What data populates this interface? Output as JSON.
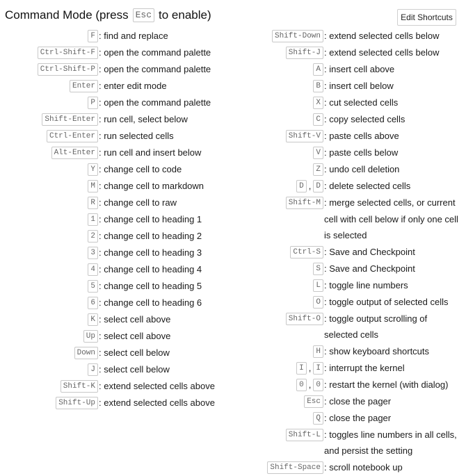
{
  "header": {
    "title_pre": "Command Mode (press",
    "title_key": "Esc",
    "title_post": "to enable)",
    "edit_button": "Edit Shortcuts"
  },
  "left": [
    {
      "keys": [
        "F"
      ],
      "desc": ": find and replace"
    },
    {
      "keys": [
        "Ctrl-Shift-F"
      ],
      "desc": ": open the command palette"
    },
    {
      "keys": [
        "Ctrl-Shift-P"
      ],
      "desc": ": open the command palette"
    },
    {
      "keys": [
        "Enter"
      ],
      "desc": ": enter edit mode"
    },
    {
      "keys": [
        "P"
      ],
      "desc": ": open the command palette"
    },
    {
      "keys": [
        "Shift-Enter"
      ],
      "desc": ": run cell, select below"
    },
    {
      "keys": [
        "Ctrl-Enter"
      ],
      "desc": ": run selected cells"
    },
    {
      "keys": [
        "Alt-Enter"
      ],
      "desc": ": run cell and insert below"
    },
    {
      "keys": [
        "Y"
      ],
      "desc": ": change cell to code"
    },
    {
      "keys": [
        "M"
      ],
      "desc": ": change cell to markdown"
    },
    {
      "keys": [
        "R"
      ],
      "desc": ": change cell to raw"
    },
    {
      "keys": [
        "1"
      ],
      "desc": ": change cell to heading 1"
    },
    {
      "keys": [
        "2"
      ],
      "desc": ": change cell to heading 2"
    },
    {
      "keys": [
        "3"
      ],
      "desc": ": change cell to heading 3"
    },
    {
      "keys": [
        "4"
      ],
      "desc": ": change cell to heading 4"
    },
    {
      "keys": [
        "5"
      ],
      "desc": ": change cell to heading 5"
    },
    {
      "keys": [
        "6"
      ],
      "desc": ": change cell to heading 6"
    },
    {
      "keys": [
        "K"
      ],
      "desc": ": select cell above"
    },
    {
      "keys": [
        "Up"
      ],
      "desc": ": select cell above"
    },
    {
      "keys": [
        "Down"
      ],
      "desc": ": select cell below"
    },
    {
      "keys": [
        "J"
      ],
      "desc": ": select cell below"
    },
    {
      "keys": [
        "Shift-K"
      ],
      "desc": ": extend selected cells above"
    },
    {
      "keys": [
        "Shift-Up"
      ],
      "desc": ": extend selected cells above"
    }
  ],
  "right": [
    {
      "keys": [
        "Shift-Down"
      ],
      "desc": ": extend selected cells below"
    },
    {
      "keys": [
        "Shift-J"
      ],
      "desc": ": extend selected cells below"
    },
    {
      "keys": [
        "A"
      ],
      "desc": ": insert cell above"
    },
    {
      "keys": [
        "B"
      ],
      "desc": ": insert cell below"
    },
    {
      "keys": [
        "X"
      ],
      "desc": ": cut selected cells"
    },
    {
      "keys": [
        "C"
      ],
      "desc": ": copy selected cells"
    },
    {
      "keys": [
        "Shift-V"
      ],
      "desc": ": paste cells above"
    },
    {
      "keys": [
        "V"
      ],
      "desc": ": paste cells below"
    },
    {
      "keys": [
        "Z"
      ],
      "desc": ": undo cell deletion"
    },
    {
      "keys": [
        "D",
        "D"
      ],
      "desc": ": delete selected cells"
    },
    {
      "keys": [
        "Shift-M"
      ],
      "desc": ": merge selected cells, or current cell with cell below if only one cell is selected"
    },
    {
      "keys": [
        "Ctrl-S"
      ],
      "desc": ": Save and Checkpoint"
    },
    {
      "keys": [
        "S"
      ],
      "desc": ": Save and Checkpoint"
    },
    {
      "keys": [
        "L"
      ],
      "desc": ": toggle line numbers"
    },
    {
      "keys": [
        "O"
      ],
      "desc": ": toggle output of selected cells"
    },
    {
      "keys": [
        "Shift-O"
      ],
      "desc": ": toggle output scrolling of selected cells"
    },
    {
      "keys": [
        "H"
      ],
      "desc": ": show keyboard shortcuts"
    },
    {
      "keys": [
        "I",
        "I"
      ],
      "desc": ": interrupt the kernel"
    },
    {
      "keys": [
        "0",
        "0"
      ],
      "desc": ": restart the kernel (with dialog)"
    },
    {
      "keys": [
        "Esc"
      ],
      "desc": ": close the pager"
    },
    {
      "keys": [
        "Q"
      ],
      "desc": ": close the pager"
    },
    {
      "keys": [
        "Shift-L"
      ],
      "desc": ": toggles line numbers in all cells, and persist the setting"
    },
    {
      "keys": [
        "Shift-Space"
      ],
      "desc": ": scroll notebook up"
    }
  ]
}
